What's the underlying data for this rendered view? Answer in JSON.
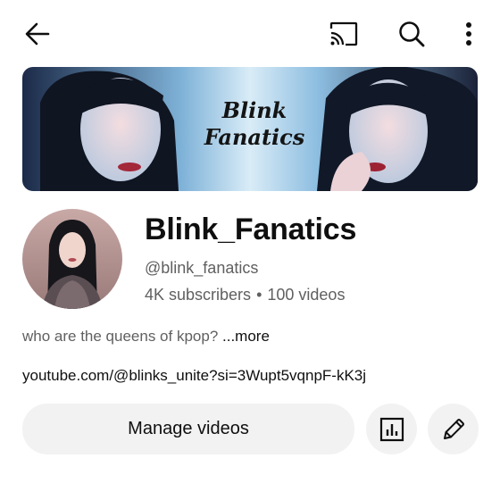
{
  "topbar": {
    "back_icon": "arrow-left-icon",
    "cast_icon": "cast-icon",
    "search_icon": "search-icon",
    "menu_icon": "more-vertical-icon"
  },
  "banner": {
    "text_line1": "Blink",
    "text_line2": "Fanatics"
  },
  "channel": {
    "name": "Blink_Fanatics",
    "handle": "@blink_fanatics",
    "subscribers": "4K subscribers",
    "separator": "•",
    "videos": "100 videos",
    "description": "who are the queens of kpop? ",
    "more_label": "...more",
    "link": "youtube.com/@blinks_unite?si=3Wupt5vqnpF-kK3j"
  },
  "actions": {
    "manage_videos_label": "Manage videos",
    "analytics_icon": "analytics-icon",
    "edit_icon": "pencil-icon"
  },
  "colors": {
    "background": "#ffffff",
    "button_bg": "#f2f2f2",
    "text_primary": "#0f0f0f",
    "text_secondary": "#606060"
  }
}
